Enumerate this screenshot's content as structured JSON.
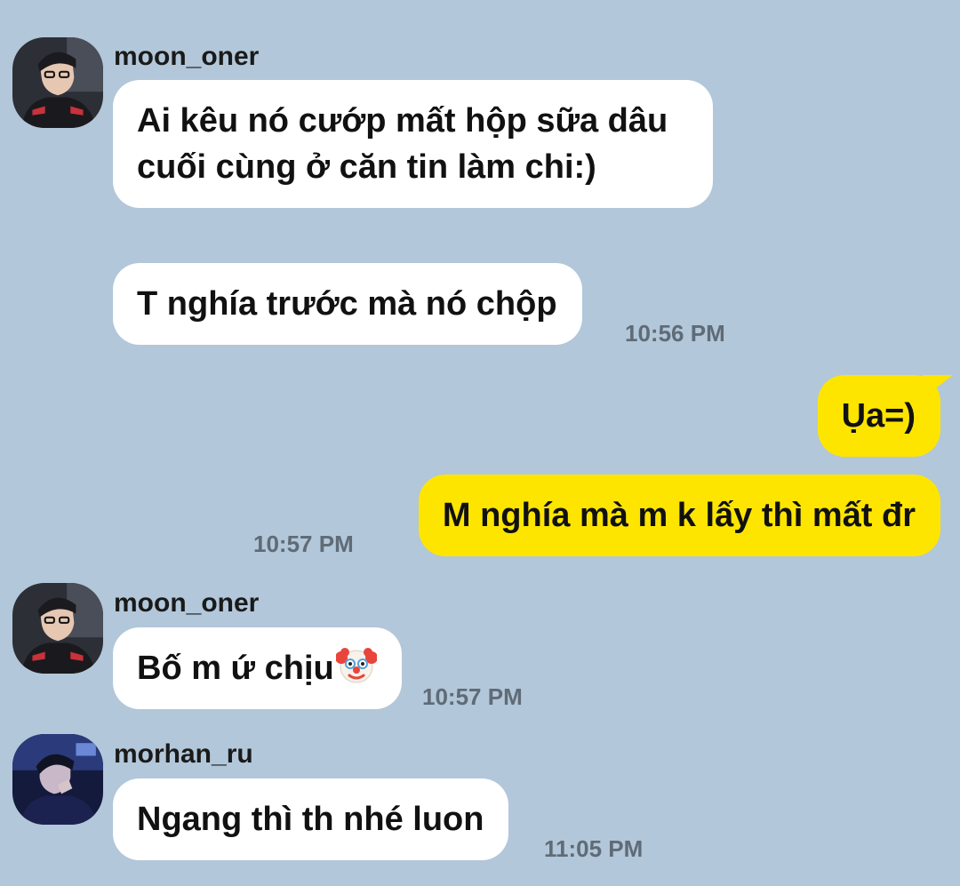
{
  "messages": [
    {
      "sender": "moon_oner",
      "bubbles": [
        "Ai kêu nó cướp mất hộp sữa dâu cuối cùng ở căn tin làm chi:)",
        "T nghía trước mà nó chộp"
      ],
      "time": "10:56 PM"
    },
    {
      "sender": "me",
      "bubbles": [
        "Ụa=)",
        "M nghía mà m k lấy thì mất đr"
      ],
      "time": "10:57 PM"
    },
    {
      "sender": "moon_oner",
      "bubbles": [
        "Bố m ứ chịu"
      ],
      "emoji": "clown-face-icon",
      "time": "10:57 PM"
    },
    {
      "sender": "morhan_ru",
      "bubbles": [
        "Ngang thì th nhé luon"
      ],
      "time": "11:05 PM"
    }
  ],
  "colors": {
    "background": "#b2c7d9",
    "incoming_bubble": "#ffffff",
    "outgoing_bubble": "#fee500",
    "timestamp": "#5f6b76"
  }
}
